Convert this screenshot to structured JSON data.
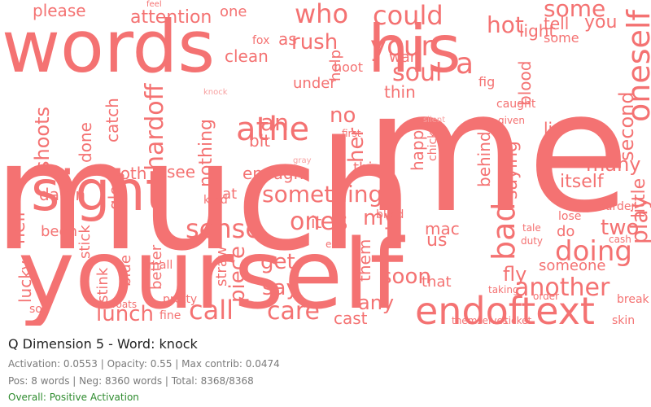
{
  "colors": {
    "word": "#f47272",
    "word_alt": "#f58080",
    "small_word": "#f7a0a0",
    "positive": "#2e8b2e",
    "muted": "#7a7a7a"
  },
  "cloud": {
    "words": [
      "much",
      "me",
      "words",
      "his",
      "yourself",
      "sight",
      "could",
      "your",
      "who",
      "soul",
      "endoftext",
      "another",
      "some",
      "oneself",
      "doing",
      "hot",
      "rush",
      "attention",
      "please",
      "athe",
      "an",
      "no",
      "something",
      "sense",
      "ones",
      "my",
      "her",
      "bad",
      "call",
      "care",
      "lunch",
      "hardoff",
      "nothing",
      "glory",
      "catch",
      "hell",
      "lucky",
      "done",
      "shoots",
      "been",
      "damn",
      "both",
      "see",
      "eat",
      "enough",
      "get",
      "say",
      "piece",
      "any",
      "soon",
      "two",
      "many",
      "itself",
      "lip",
      "second",
      "little",
      "saying",
      "fly",
      "cast",
      "it",
      "us",
      "them",
      "that",
      "mac",
      "happy",
      "behind",
      "war",
      "help",
      "bit",
      "as",
      "one",
      "fox",
      "feel",
      "play",
      "tell",
      "light",
      "you",
      "blood",
      "fig",
      "thin",
      "this",
      "some",
      "a",
      "someone",
      "murder",
      "lose",
      "tale",
      "duty",
      "taking",
      "cash",
      "break",
      "skin",
      "under",
      "fine",
      "better",
      "straw",
      "pretty",
      "stick",
      "stink",
      "blue",
      "small",
      "lowoats",
      "so",
      "do",
      "kind",
      "clean",
      "hoot",
      "caught",
      "given",
      "first",
      "chicken",
      "blind",
      "order",
      "end",
      "themselves",
      "ticket",
      "gray",
      "silent",
      "knock"
    ]
  },
  "panel": {
    "title": "Q Dimension 5 - Word: knock",
    "stats_line1": "Activation: 0.0553 | Opacity: 0.55 | Max contrib: 0.0474",
    "stats_line2": "Pos: 8 words | Neg: 8360 words | Total: 8368/8368",
    "overall": "Overall: Positive Activation"
  }
}
